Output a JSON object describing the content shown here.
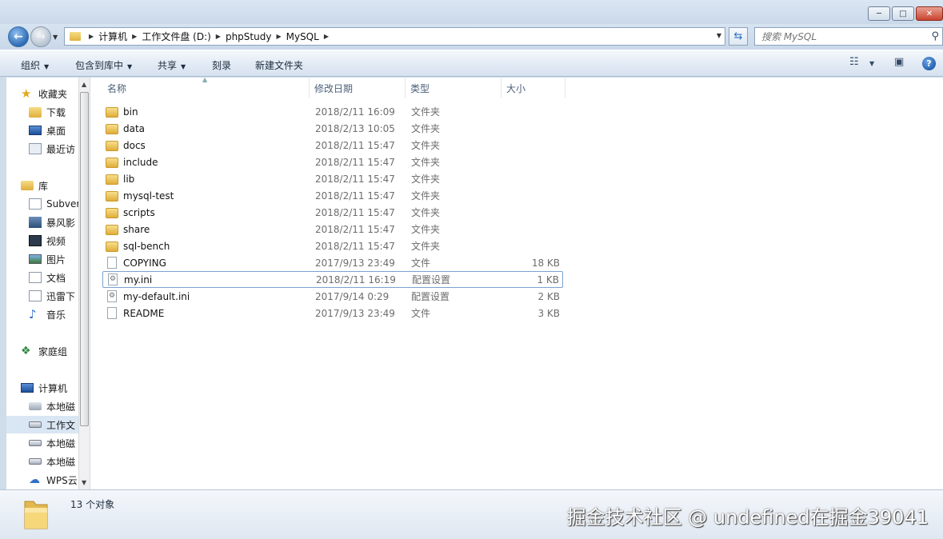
{
  "window": {
    "minimize": "─",
    "maximize": "□",
    "close": "✕"
  },
  "address": {
    "breadcrumbs": [
      "计算机",
      "工作文件盘 (D:)",
      "phpStudy",
      "MySQL"
    ],
    "search_placeholder": "搜索 MySQL"
  },
  "toolbar": {
    "organize": "组织",
    "include_library": "包含到库中",
    "share": "共享",
    "burn": "刻录",
    "new_folder": "新建文件夹"
  },
  "sidebar": {
    "items": [
      {
        "label": "收藏夹",
        "icon": "star-icon"
      },
      {
        "label": "下载",
        "icon": "download-folder-icon"
      },
      {
        "label": "桌面",
        "icon": "desktop-icon"
      },
      {
        "label": "最近访",
        "icon": "recent-places-icon"
      },
      {
        "label": "库",
        "icon": "library-icon"
      },
      {
        "label": "Subver",
        "icon": "library-doc-icon"
      },
      {
        "label": "暴风影",
        "icon": "video-library-icon"
      },
      {
        "label": "视频",
        "icon": "video-icon"
      },
      {
        "label": "图片",
        "icon": "pictures-icon"
      },
      {
        "label": "文档",
        "icon": "documents-icon"
      },
      {
        "label": "迅雷下",
        "icon": "thunder-download-icon"
      },
      {
        "label": "音乐",
        "icon": "music-icon"
      },
      {
        "label": "家庭组",
        "icon": "homegroup-icon"
      },
      {
        "label": "计算机",
        "icon": "computer-icon"
      },
      {
        "label": "本地磁",
        "icon": "system-drive-icon"
      },
      {
        "label": "工作文",
        "icon": "drive-icon"
      },
      {
        "label": "本地磁",
        "icon": "drive-icon"
      },
      {
        "label": "本地磁",
        "icon": "drive-icon"
      },
      {
        "label": "WPS云",
        "icon": "cloud-icon"
      }
    ]
  },
  "columns": {
    "name": "名称",
    "modified": "修改日期",
    "type": "类型",
    "size": "大小"
  },
  "files": [
    {
      "name": "bin",
      "date": "2018/2/11 16:09",
      "type": "文件夹",
      "size": "",
      "kind": "folder"
    },
    {
      "name": "data",
      "date": "2018/2/13 10:05",
      "type": "文件夹",
      "size": "",
      "kind": "folder"
    },
    {
      "name": "docs",
      "date": "2018/2/11 15:47",
      "type": "文件夹",
      "size": "",
      "kind": "folder"
    },
    {
      "name": "include",
      "date": "2018/2/11 15:47",
      "type": "文件夹",
      "size": "",
      "kind": "folder"
    },
    {
      "name": "lib",
      "date": "2018/2/11 15:47",
      "type": "文件夹",
      "size": "",
      "kind": "folder"
    },
    {
      "name": "mysql-test",
      "date": "2018/2/11 15:47",
      "type": "文件夹",
      "size": "",
      "kind": "folder"
    },
    {
      "name": "scripts",
      "date": "2018/2/11 15:47",
      "type": "文件夹",
      "size": "",
      "kind": "folder"
    },
    {
      "name": "share",
      "date": "2018/2/11 15:47",
      "type": "文件夹",
      "size": "",
      "kind": "folder"
    },
    {
      "name": "sql-bench",
      "date": "2018/2/11 15:47",
      "type": "文件夹",
      "size": "",
      "kind": "folder"
    },
    {
      "name": "COPYING",
      "date": "2017/9/13 23:49",
      "type": "文件",
      "size": "18 KB",
      "kind": "file"
    },
    {
      "name": "my.ini",
      "date": "2018/2/11 16:19",
      "type": "配置设置",
      "size": "1 KB",
      "kind": "ini"
    },
    {
      "name": "my-default.ini",
      "date": "2017/9/14 0:29",
      "type": "配置设置",
      "size": "2 KB",
      "kind": "ini"
    },
    {
      "name": "README",
      "date": "2017/9/13 23:49",
      "type": "文件",
      "size": "3 KB",
      "kind": "file"
    }
  ],
  "status": {
    "count_text": "13 个对象"
  },
  "watermark": "掘金技术社区 @ undefined在掘金39041"
}
